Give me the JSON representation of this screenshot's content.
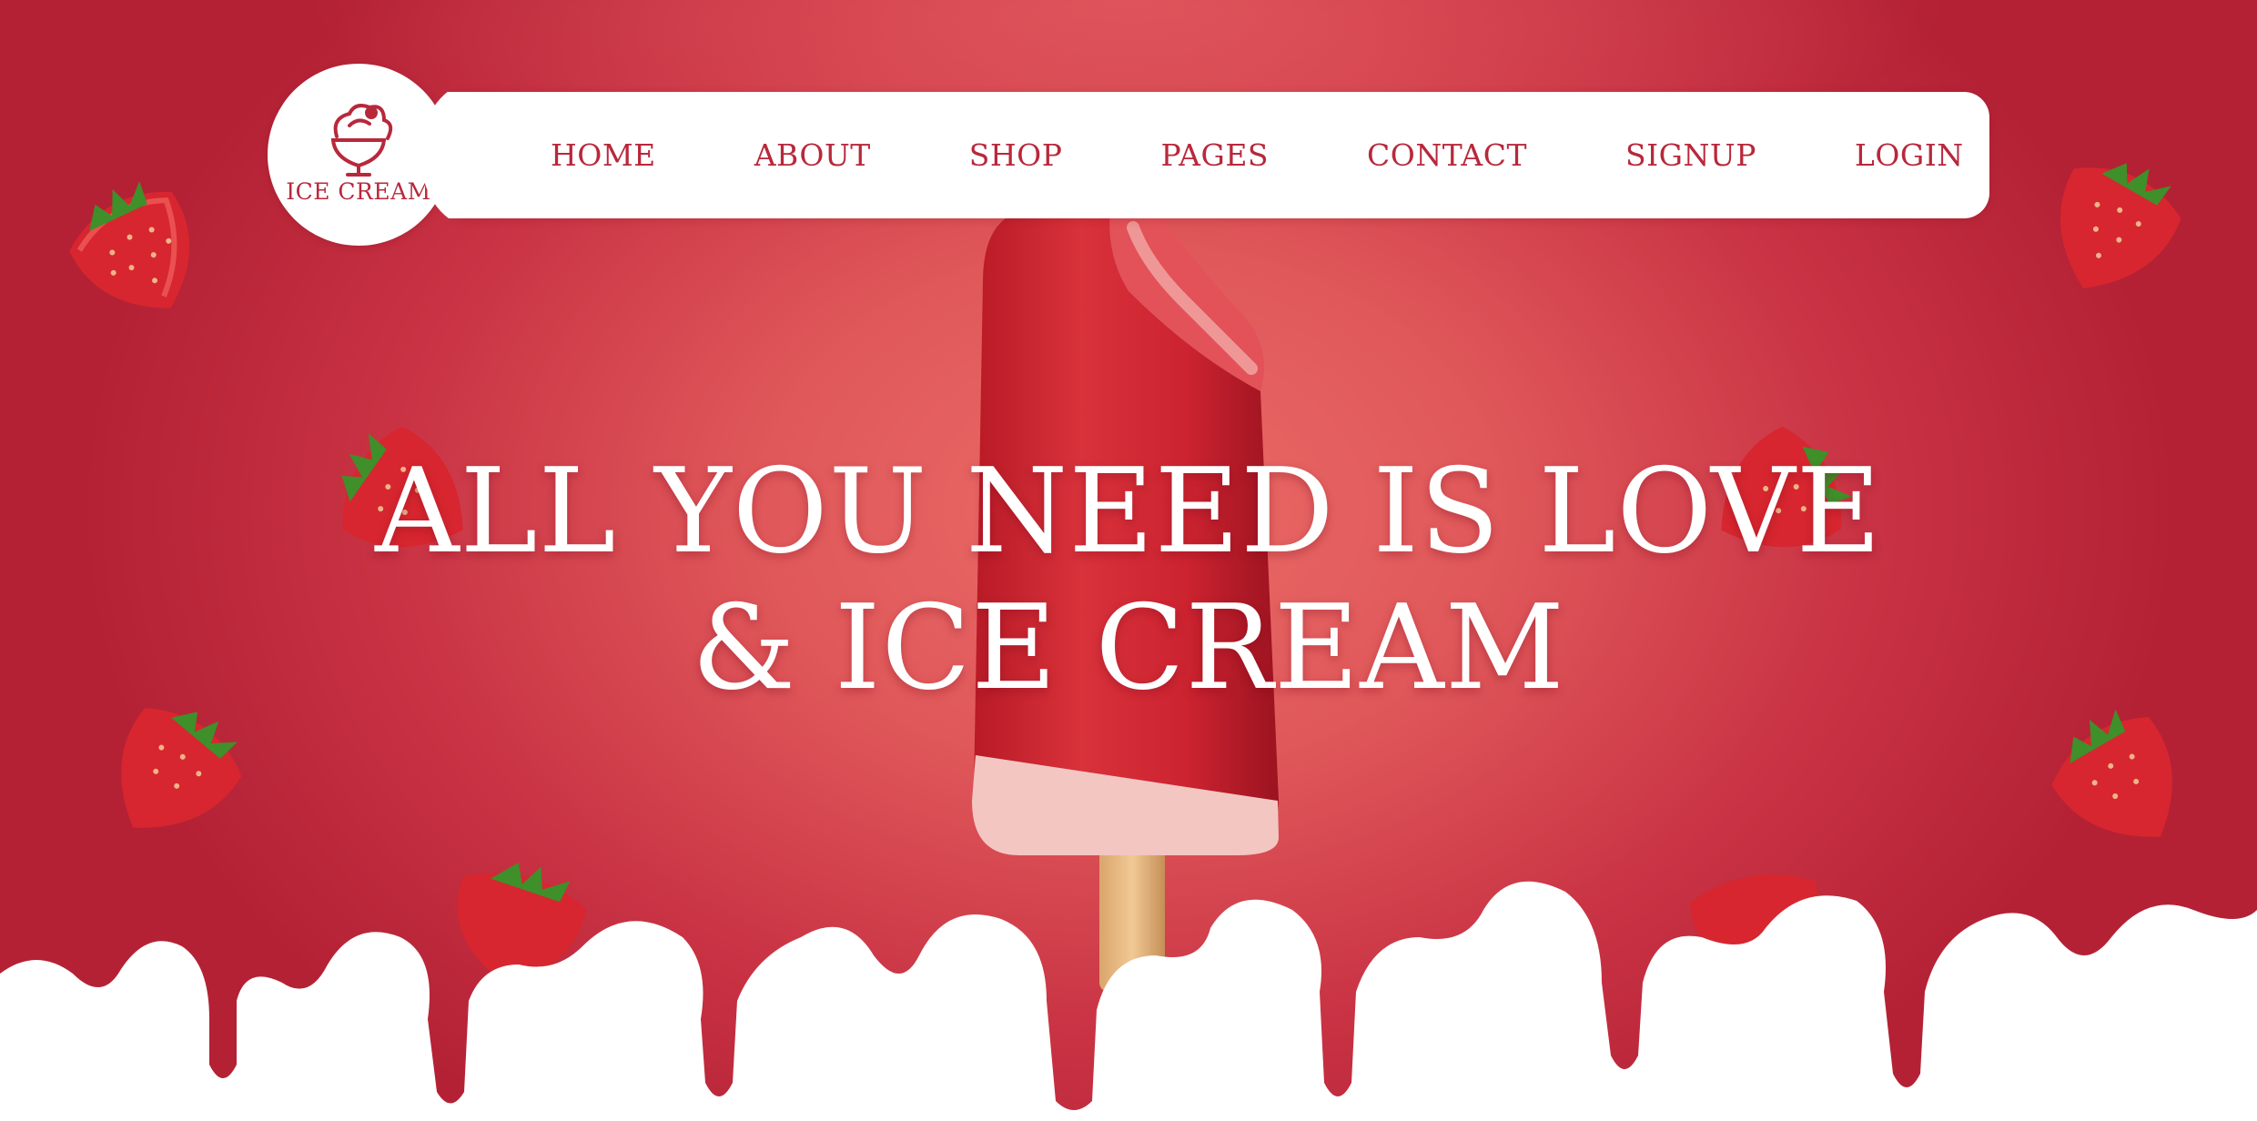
{
  "brand": {
    "logo_text": "ICE CREAM",
    "logo_icon": "ice-cream-cup-icon"
  },
  "nav": {
    "items": [
      {
        "label": "HOME"
      },
      {
        "label": "ABOUT"
      },
      {
        "label": "SHOP"
      },
      {
        "label": "PAGES"
      },
      {
        "label": "CONTACT"
      },
      {
        "label": "SIGNUP"
      },
      {
        "label": "LOGIN"
      }
    ]
  },
  "hero": {
    "headline_line1": "ALL YOU NEED IS LOVE",
    "headline_line2": "& ICE CREAM",
    "product_image": "strawberry-popsicle",
    "decoration": "strawberry-icon"
  },
  "colors": {
    "brand_red": "#b8283b",
    "background_red": "#c93344",
    "background_glow": "#ea6b67",
    "text_white": "#ffffff"
  }
}
